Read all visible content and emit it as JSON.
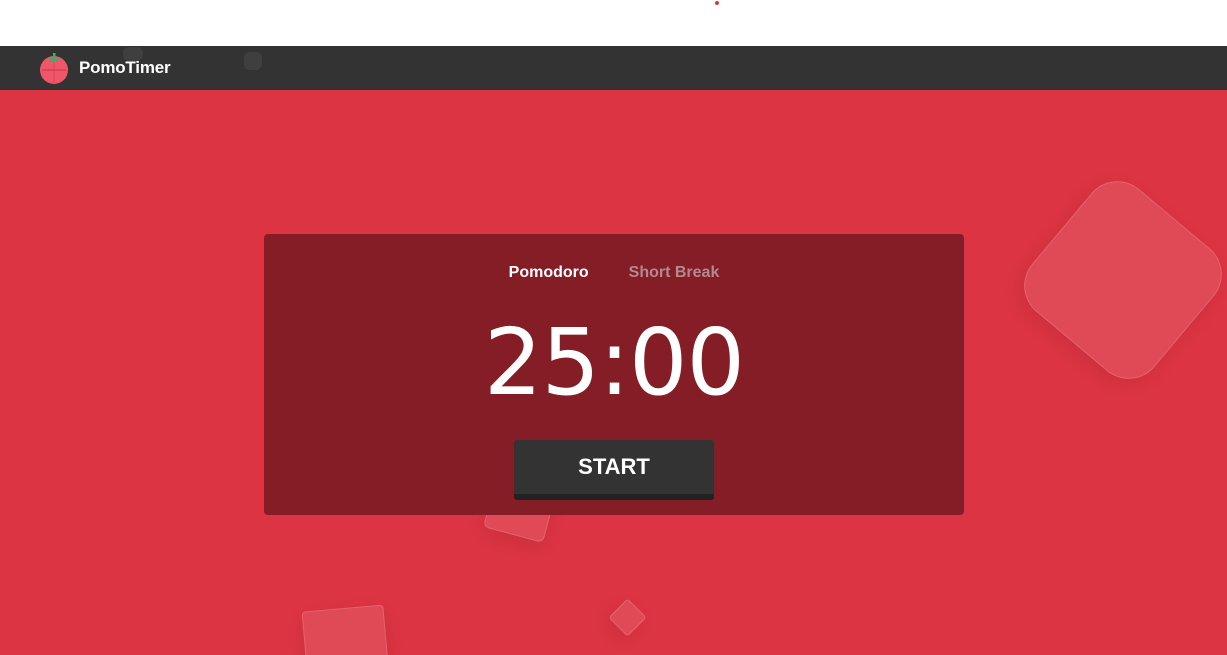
{
  "app": {
    "name": "PomoTimer",
    "logo_icon": "tomato-icon"
  },
  "timer": {
    "tabs": [
      {
        "label": "Pomodoro",
        "active": true
      },
      {
        "label": "Short Break",
        "active": false
      }
    ],
    "time": "25:00",
    "start_label": "START"
  },
  "colors": {
    "navbar": "#333333",
    "background": "#dc3442",
    "card": "#851d26",
    "button": "#333333",
    "tab_inactive": "#b28a8e"
  }
}
